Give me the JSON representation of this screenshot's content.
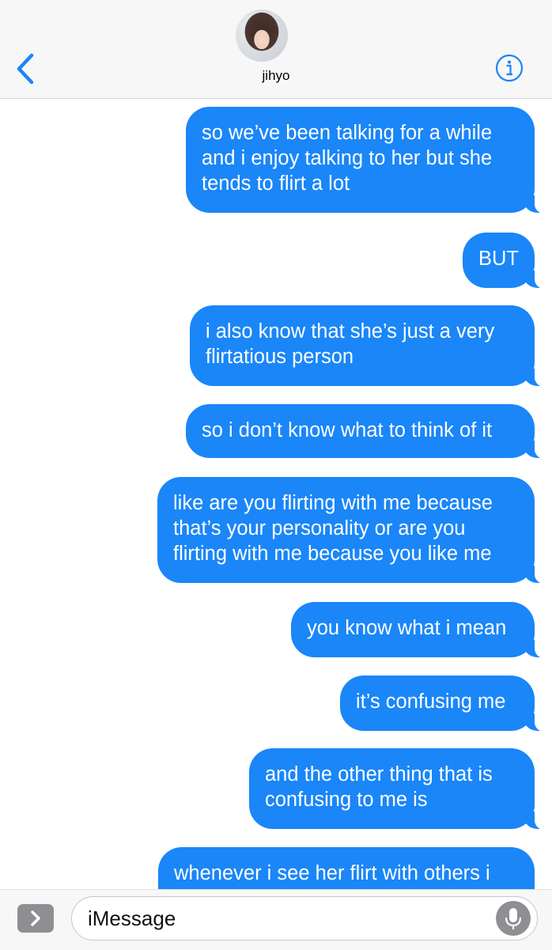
{
  "header": {
    "contact_name": "jihyo",
    "accent_color": "#1a86f8",
    "icons": [
      "chevron-left-icon",
      "info-icon",
      "avatar"
    ]
  },
  "messages": [
    {
      "text": "so we’ve been talking for a while\nand i enjoy talking to her but she\ntends to flirt a lot"
    },
    {
      "text": "BUT"
    },
    {
      "text": "i also know that she’s just a very\nflirtatious person"
    },
    {
      "text": "so i don’t know what to think of it"
    },
    {
      "text": "like are you flirting with me because\nthat’s your personality or are you\nflirting with me because you like me"
    },
    {
      "text": "you know what i mean"
    },
    {
      "text": "it’s confusing me"
    },
    {
      "text": "and the other thing that is\nconfusing to me is"
    },
    {
      "text": "whenever i see her flirt with others i"
    }
  ],
  "compose": {
    "placeholder": "iMessage",
    "icons": [
      "apps-chevron-icon",
      "microphone-icon"
    ]
  }
}
